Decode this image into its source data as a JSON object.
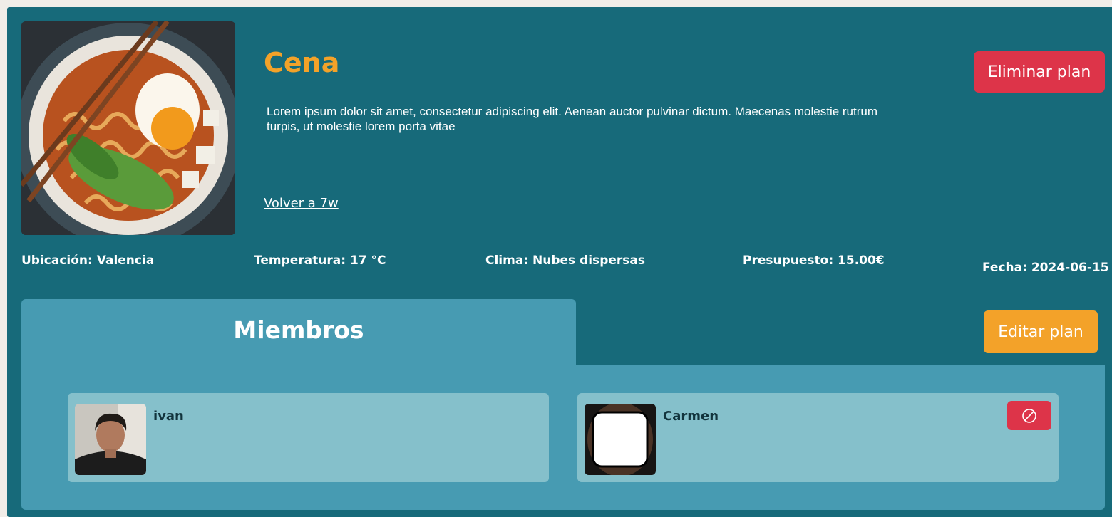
{
  "plan": {
    "title": "Cena",
    "description": "Lorem ipsum dolor sit amet, consectetur adipiscing elit. Aenean auctor pulvinar dictum. Maecenas molestie rutrum turpis, ut molestie lorem porta vitae",
    "back_link": "Volver a 7w",
    "delete_label": "Eliminar plan",
    "edit_label": "Editar plan",
    "image_icon": "ramen-bowl-photo"
  },
  "info": {
    "location": "Ubicación: Valencia",
    "temperature": "Temperatura: 17 °C",
    "weather": "Clima: Nubes dispersas",
    "budget": "Presupuesto: 15.00€",
    "date": "Fecha: 2024-06-15"
  },
  "members": {
    "title": "Miembros",
    "list": [
      {
        "name": "ivan",
        "avatar_icon": "user-photo"
      },
      {
        "name": "Carmen",
        "avatar_icon": "user-photo-placeholder",
        "remove_icon": "ban-icon"
      }
    ]
  },
  "colors": {
    "panel": "#176a7a",
    "accent_orange": "#f3a229",
    "danger_red": "#dd3449",
    "section": "#479bb2",
    "card": "#85c0cb"
  }
}
